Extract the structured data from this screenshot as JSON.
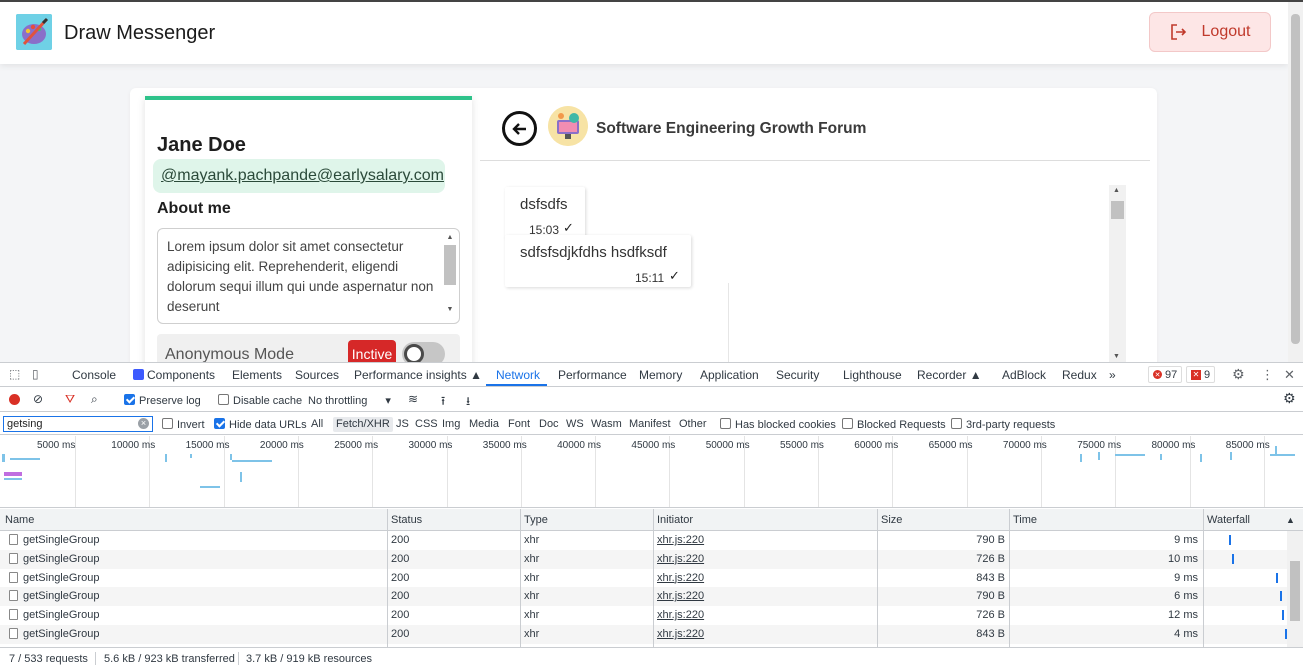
{
  "app": {
    "title": "Draw Messenger",
    "logout_label": "Logout"
  },
  "profile": {
    "name": "Jane Doe",
    "email": "@mayank.pachpande@earlysalary.com",
    "about_label": "About me",
    "about_text": "Lorem ipsum dolor sit amet consectetur adipisicing elit. Reprehenderit, eligendi dolorum sequi illum qui unde aspernatur non deserunt",
    "anonymous_label": "Anonymous Mode",
    "anonymous_status": "Inctive"
  },
  "chat": {
    "group_name": "Software Engineering Growth Forum",
    "messages": [
      {
        "text": "dsfsdfs",
        "time": "15:03"
      },
      {
        "text": "sdfsfsdjkfdhs hsdfksdf",
        "time": "15:11"
      }
    ]
  },
  "devtools": {
    "tabs": [
      "Console",
      "Components",
      "Elements",
      "Sources",
      "Performance insights",
      "Network",
      "Performance",
      "Memory",
      "Application",
      "Security",
      "Lighthouse",
      "Recorder",
      "AdBlock",
      "Redux"
    ],
    "more_tabs": "»",
    "error_count": "97",
    "warning_count": "9",
    "toolbar": {
      "preserve_log": "Preserve log",
      "disable_cache": "Disable cache",
      "throttling": "No throttling"
    },
    "filter": {
      "value": "getsing",
      "invert": "Invert",
      "hide_data_urls": "Hide data URLs",
      "types": [
        "All",
        "Fetch/XHR",
        "JS",
        "CSS",
        "Img",
        "Media",
        "Font",
        "Doc",
        "WS",
        "Wasm",
        "Manifest",
        "Other"
      ],
      "has_blocked_cookies": "Has blocked cookies",
      "blocked_requests": "Blocked Requests",
      "third_party": "3rd-party requests"
    },
    "timeline_ticks": [
      "5000 ms",
      "10000 ms",
      "15000 ms",
      "20000 ms",
      "25000 ms",
      "30000 ms",
      "35000 ms",
      "40000 ms",
      "45000 ms",
      "50000 ms",
      "55000 ms",
      "60000 ms",
      "65000 ms",
      "70000 ms",
      "75000 ms",
      "80000 ms",
      "85000 ms"
    ],
    "columns": [
      "Name",
      "Status",
      "Type",
      "Initiator",
      "Size",
      "Time",
      "Waterfall"
    ],
    "rows": [
      {
        "name": "getSingleGroup",
        "status": "200",
        "type": "xhr",
        "initiator": "xhr.js:220",
        "size": "790 B",
        "time": "9 ms"
      },
      {
        "name": "getSingleGroup",
        "status": "200",
        "type": "xhr",
        "initiator": "xhr.js:220",
        "size": "726 B",
        "time": "10 ms"
      },
      {
        "name": "getSingleGroup",
        "status": "200",
        "type": "xhr",
        "initiator": "xhr.js:220",
        "size": "843 B",
        "time": "9 ms"
      },
      {
        "name": "getSingleGroup",
        "status": "200",
        "type": "xhr",
        "initiator": "xhr.js:220",
        "size": "790 B",
        "time": "6 ms"
      },
      {
        "name": "getSingleGroup",
        "status": "200",
        "type": "xhr",
        "initiator": "xhr.js:220",
        "size": "726 B",
        "time": "12 ms"
      },
      {
        "name": "getSingleGroup",
        "status": "200",
        "type": "xhr",
        "initiator": "xhr.js:220",
        "size": "843 B",
        "time": "4 ms"
      }
    ],
    "status": {
      "requests": "7 / 533 requests",
      "transferred": "5.6 kB / 923 kB transferred",
      "resources": "3.7 kB / 919 kB resources"
    }
  }
}
